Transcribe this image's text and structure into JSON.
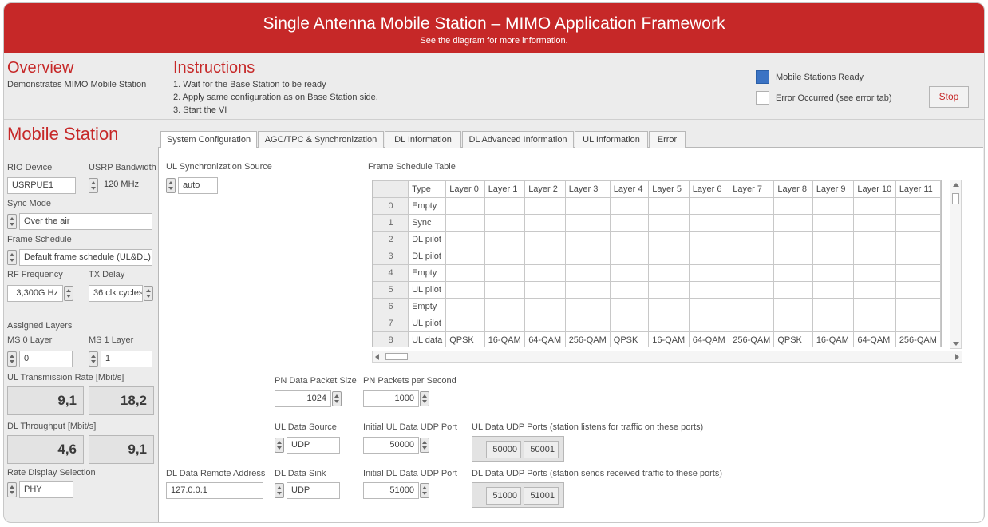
{
  "header": {
    "title": "Single Antenna Mobile Station – MIMO Application Framework",
    "subtitle": "See the diagram for more information."
  },
  "overview": {
    "heading": "Overview",
    "text": "Demonstrates MIMO Mobile Station"
  },
  "instructions": {
    "heading": "Instructions",
    "steps": [
      "1. Wait for the Base Station to be ready",
      "2. Apply same configuration as on Base Station side.",
      "3. Start the VI"
    ]
  },
  "status": {
    "ready_label": "Mobile Stations Ready",
    "ready_color": "#3b73c4",
    "error_label": "Error Occurred (see error tab)",
    "stop_label": "Stop"
  },
  "sidebar": {
    "heading": "Mobile Station",
    "rio_device_label": "RIO Device",
    "rio_device_value": "USRPUE1",
    "usrp_bandwidth_label": "USRP Bandwidth",
    "usrp_bandwidth_value": "120 MHz",
    "sync_mode_label": "Sync Mode",
    "sync_mode_value": "Over the air",
    "frame_schedule_label": "Frame Schedule",
    "frame_schedule_value": "Default frame schedule (UL&DL)",
    "rf_frequency_label": "RF Frequency",
    "rf_frequency_value": "3,300G Hz",
    "tx_delay_label": "TX Delay",
    "tx_delay_value": "36 clk cycles",
    "assigned_layers_label": "Assigned Layers",
    "ms0_layer_label": "MS 0 Layer",
    "ms0_layer_value": "0",
    "ms1_layer_label": "MS 1 Layer",
    "ms1_layer_value": "1",
    "ul_rate_label": "UL Transmission Rate [Mbit/s]",
    "ul_rate_values": [
      "9,1",
      "18,2"
    ],
    "dl_throughput_label": "DL Throughput [Mbit/s]",
    "dl_throughput_values": [
      "4,6",
      "9,1"
    ],
    "rate_display_label": "Rate Display Selection",
    "rate_display_value": "PHY"
  },
  "tabs": [
    {
      "label": "System Configuration"
    },
    {
      "label": "AGC/TPC & Synchronization"
    },
    {
      "label": "DL Information"
    },
    {
      "label": "DL Advanced Information"
    },
    {
      "label": "UL Information"
    },
    {
      "label": "Error"
    }
  ],
  "config": {
    "ul_sync_source_label": "UL Synchronization Source",
    "ul_sync_source_value": "auto",
    "frame_table_label": "Frame Schedule Table",
    "pn_packet_size_label": "PN Data Packet Size",
    "pn_packet_size_value": "1024",
    "pn_packets_label": "PN Packets per Second",
    "pn_packets_value": "1000",
    "ul_data_source_label": "UL Data Source",
    "ul_data_source_value": "UDP",
    "initial_ul_port_label": "Initial UL Data UDP Port",
    "initial_ul_port_value": "50000",
    "ul_ports_label": "UL Data UDP Ports (station listens for traffic on these ports)",
    "ul_ports": [
      "50000",
      "50001"
    ],
    "dl_remote_label": "DL Data Remote Address",
    "dl_remote_value": "127.0.0.1",
    "dl_sink_label": "DL Data Sink",
    "dl_sink_value": "UDP",
    "initial_dl_port_label": "Initial DL Data UDP Port",
    "initial_dl_port_value": "51000",
    "dl_ports_label": "DL Data UDP Ports (station sends received traffic to these ports)",
    "dl_ports": [
      "51000",
      "51001"
    ]
  },
  "frame_table": {
    "columns": [
      "Type",
      "Layer 0",
      "Layer 1",
      "Layer 2",
      "Layer 3",
      "Layer 4",
      "Layer 5",
      "Layer 6",
      "Layer 7",
      "Layer 8",
      "Layer 9",
      "Layer 10",
      "Layer 11"
    ],
    "rows": [
      {
        "index": "0",
        "cells": [
          "Empty",
          "",
          "",
          "",
          "",
          "",
          "",
          "",
          "",
          "",
          "",
          "",
          ""
        ]
      },
      {
        "index": "1",
        "cells": [
          "Sync",
          "",
          "",
          "",
          "",
          "",
          "",
          "",
          "",
          "",
          "",
          "",
          ""
        ]
      },
      {
        "index": "2",
        "cells": [
          "DL pilot",
          "",
          "",
          "",
          "",
          "",
          "",
          "",
          "",
          "",
          "",
          "",
          ""
        ]
      },
      {
        "index": "3",
        "cells": [
          "DL pilot",
          "",
          "",
          "",
          "",
          "",
          "",
          "",
          "",
          "",
          "",
          "",
          ""
        ]
      },
      {
        "index": "4",
        "cells": [
          "Empty",
          "",
          "",
          "",
          "",
          "",
          "",
          "",
          "",
          "",
          "",
          "",
          ""
        ]
      },
      {
        "index": "5",
        "cells": [
          "UL pilot",
          "",
          "",
          "",
          "",
          "",
          "",
          "",
          "",
          "",
          "",
          "",
          ""
        ]
      },
      {
        "index": "6",
        "cells": [
          "Empty",
          "",
          "",
          "",
          "",
          "",
          "",
          "",
          "",
          "",
          "",
          "",
          ""
        ]
      },
      {
        "index": "7",
        "cells": [
          "UL pilot",
          "",
          "",
          "",
          "",
          "",
          "",
          "",
          "",
          "",
          "",
          "",
          ""
        ]
      },
      {
        "index": "8",
        "cells": [
          "UL data",
          "QPSK",
          "16-QAM",
          "64-QAM",
          "256-QAM",
          "QPSK",
          "16-QAM",
          "64-QAM",
          "256-QAM",
          "QPSK",
          "16-QAM",
          "64-QAM",
          "256-QAM"
        ]
      }
    ]
  }
}
